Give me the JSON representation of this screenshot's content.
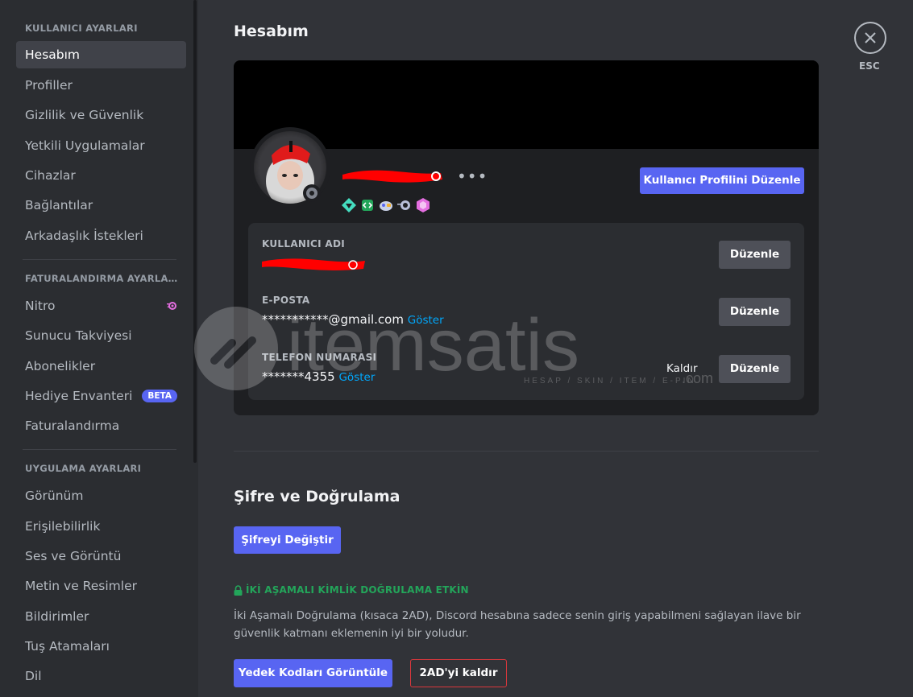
{
  "sidebar": {
    "sections": [
      {
        "header": "KULLANICI AYARLARI",
        "items": [
          {
            "label": "Hesabım",
            "active": true
          },
          {
            "label": "Profiller"
          },
          {
            "label": "Gizlilik ve Güvenlik"
          },
          {
            "label": "Yetkili Uygulamalar"
          },
          {
            "label": "Cihazlar"
          },
          {
            "label": "Bağlantılar"
          },
          {
            "label": "Arkadaşlık İstekleri"
          }
        ]
      },
      {
        "header": "FATURALANDIRMA AYARLARI",
        "items": [
          {
            "label": "Nitro",
            "icon": "nitro-icon"
          },
          {
            "label": "Sunucu Takviyesi"
          },
          {
            "label": "Abonelikler"
          },
          {
            "label": "Hediye Envanteri",
            "badge": "BETA"
          },
          {
            "label": "Faturalandırma"
          }
        ]
      },
      {
        "header": "UYGULAMA AYARLARI",
        "items": [
          {
            "label": "Görünüm"
          },
          {
            "label": "Erişilebilirlik"
          },
          {
            "label": "Ses ve Görüntü"
          },
          {
            "label": "Metin ve Resimler"
          },
          {
            "label": "Bildirimler"
          },
          {
            "label": "Tuş Atamaları"
          },
          {
            "label": "Dil"
          }
        ]
      }
    ]
  },
  "main": {
    "title": "Hesabım",
    "close_label": "ESC",
    "profile": {
      "edit_profile_button": "Kullanıcı Profilini Düzenle",
      "more_icon": "more-dots-icon",
      "badges": [
        "hypesquad-balance-icon",
        "active-developer-icon",
        "quest-icon",
        "orbs-icon",
        "nitro-gem-icon"
      ],
      "fields": [
        {
          "label": "KULLANICI ADI",
          "value": "",
          "edit": "Düzenle"
        },
        {
          "label": "E-POSTA",
          "value": "***********@gmail.com",
          "show": "Göster",
          "edit": "Düzenle"
        },
        {
          "label": "TELEFON NUMARASI",
          "value": "*******4355",
          "show": "Göster",
          "remove": "Kaldır",
          "edit": "Düzenle"
        }
      ]
    },
    "password_section": {
      "title": "Şifre ve Doğrulama",
      "change_password_button": "Şifreyi Değiştir",
      "mfa_status": "İKİ AŞAMALI KİMLİK DOĞRULAMA ETKİN",
      "mfa_description": "İki Aşamalı Doğrulama (kısaca 2AD), Discord hesabına sadece senin giriş yapabilmeni sağlayan ilave bir güvenlik katmanı eklemenin iyi bir yoludur.",
      "backup_codes_button": "Yedek Kodları Görüntüle",
      "remove_2fa_button": "2AD'yi kaldır"
    },
    "watermark": {
      "brand": "itemsatis",
      "tagline": "HESAP / SKIN / ITEM / E-PIN",
      "suffix": ".com"
    }
  },
  "colors": {
    "accent": "#5865f2",
    "success": "#23a55a",
    "danger": "#da373c",
    "link": "#00a8fc"
  }
}
